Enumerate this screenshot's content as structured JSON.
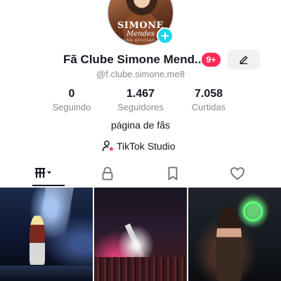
{
  "profile": {
    "avatar_text_line1": "SIMONE",
    "avatar_text_line2": "Mendes",
    "avatar_text_line3": "FÃS OFICIAIS",
    "display_name": "Fã Clube Simone Mend...",
    "notifications_badge": "9+",
    "handle": "@f.clube.simone.me8",
    "bio": "página de fãs",
    "studio_link": "TikTok Studio"
  },
  "stats": [
    {
      "value": "0",
      "label": "Seguindo"
    },
    {
      "value": "1.467",
      "label": "Seguidores"
    },
    {
      "value": "7.058",
      "label": "Curtidas"
    }
  ],
  "tabs": [
    {
      "icon": "grid-icon",
      "active": true
    },
    {
      "icon": "lock-icon",
      "active": false
    },
    {
      "icon": "bookmark-icon",
      "active": false
    },
    {
      "icon": "heart-icon",
      "active": false
    }
  ],
  "colors": {
    "accent_cyan": "#20d5ec",
    "badge_red": "#fe2c55",
    "text_primary": "#161823",
    "text_secondary": "#8a8b91"
  }
}
